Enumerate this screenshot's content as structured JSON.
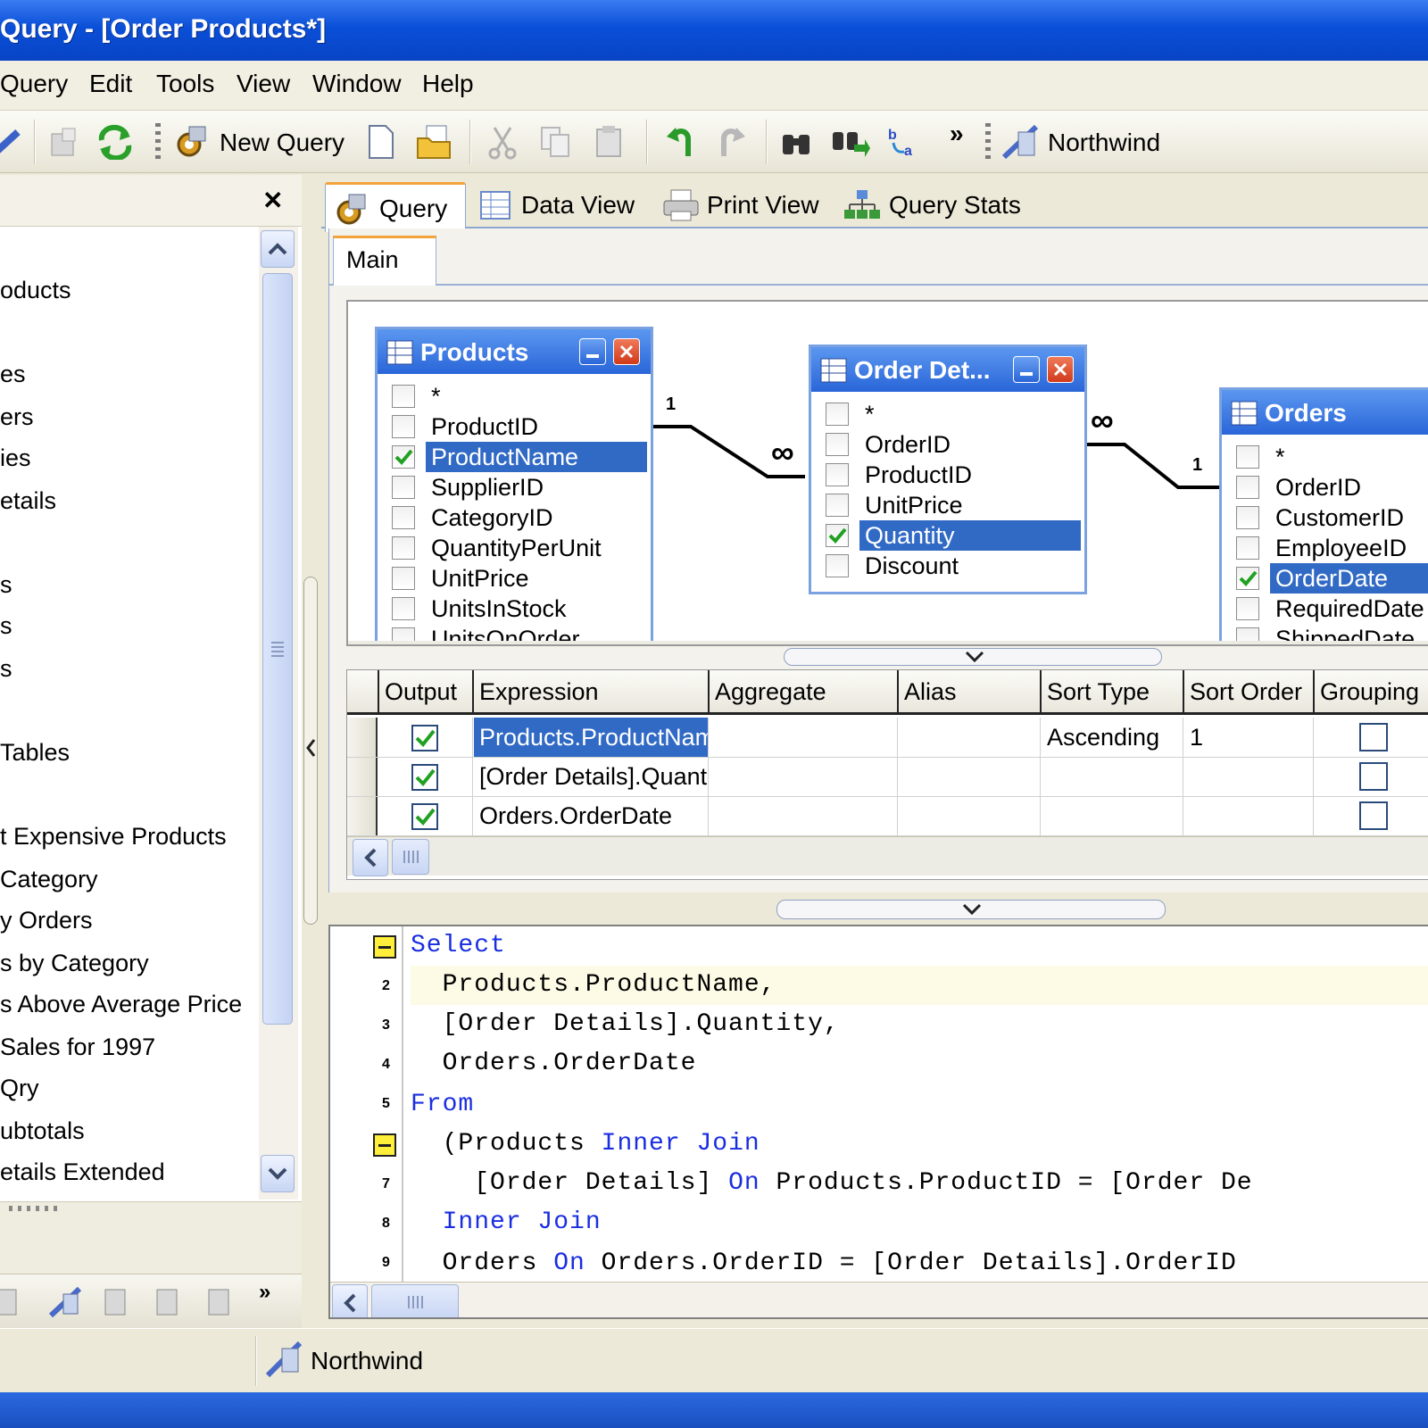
{
  "window": {
    "title": " Query  - [Order Products*]"
  },
  "menu": [
    "Query",
    "Edit",
    "Tools",
    "View",
    "Window",
    "Help"
  ],
  "toolbar": {
    "new_query_label": "New Query",
    "connection_label": "Northwind",
    "overflow": "»"
  },
  "left_panel": {
    "close_glyph": "✕",
    "items": [
      "oducts",
      "es",
      "ers",
      "ies",
      "etails",
      "s",
      "s",
      "s",
      "Tables",
      "t Expensive Products",
      " Category",
      "y Orders",
      "s by Category",
      "s Above Average Price",
      "Sales for 1997",
      "Qry",
      "ubtotals",
      "etails Extended"
    ]
  },
  "tabs": [
    "Query",
    "Data View",
    "Print View",
    "Query Stats"
  ],
  "subtab": "Main",
  "tables": {
    "products": {
      "title": "Products",
      "fields": [
        "*",
        "ProductID",
        "ProductName",
        "SupplierID",
        "CategoryID",
        "QuantityPerUnit",
        "UnitPrice",
        "UnitsInStock",
        "UnitsOnOrder"
      ]
    },
    "order_details": {
      "title": "Order Det...",
      "fields": [
        "*",
        "OrderID",
        "ProductID",
        "UnitPrice",
        "Quantity",
        "Discount"
      ]
    },
    "orders": {
      "title": "Orders",
      "fields": [
        "*",
        "OrderID",
        "CustomerID",
        "EmployeeID",
        "OrderDate",
        "RequiredDate",
        "ShippedDate"
      ]
    }
  },
  "relations": {
    "one": "1",
    "many": "∞"
  },
  "grid": {
    "headers": [
      "Output",
      "Expression",
      "Aggregate",
      "Alias",
      "Sort Type",
      "Sort Order",
      "Grouping"
    ],
    "rows": [
      {
        "expression": "Products.ProductName",
        "aggregate": "",
        "alias": "",
        "sort_type": "Ascending",
        "sort_order": "1"
      },
      {
        "expression": "[Order Details].Quantity",
        "aggregate": "",
        "alias": "",
        "sort_type": "",
        "sort_order": ""
      },
      {
        "expression": "Orders.OrderDate",
        "aggregate": "",
        "alias": "",
        "sort_type": "",
        "sort_order": ""
      }
    ]
  },
  "sql": {
    "line_numbers": [
      "2",
      "3",
      "4",
      "5",
      "7",
      "8",
      "9"
    ],
    "lines": [
      {
        "kw1": "Select"
      },
      {
        "text": "  Products.ProductName,"
      },
      {
        "text": "  [Order Details].Quantity,"
      },
      {
        "text": "  Orders.OrderDate"
      },
      {
        "kw1": "From"
      },
      {
        "pre": "  (Products ",
        "kw1": "Inner Join"
      },
      {
        "text": "    [Order Details] ",
        "kw1": "On",
        "post": " Products.ProductID = [Order De"
      },
      {
        "pre": "  ",
        "kw1": "Inner Join"
      },
      {
        "text": "  Orders ",
        "kw1": "On",
        "post": " Orders.OrderID = [Order Details].OrderID"
      }
    ]
  },
  "status": {
    "connection_label": "Northwind"
  },
  "colors": {
    "selection": "#316ac5",
    "keyword": "#1a2ee0",
    "titlebar": "#0a4fd8"
  }
}
